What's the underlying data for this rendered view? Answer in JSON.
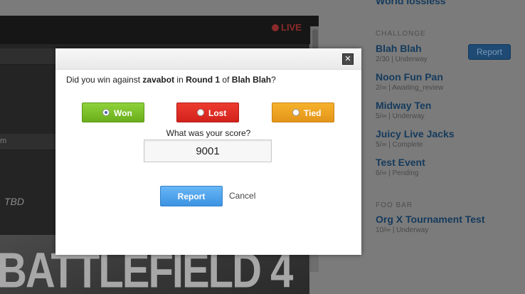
{
  "background": {
    "live_label": "LIVE",
    "strip_label": "m",
    "tbd_text": "TBD",
    "banner_text": "BATTLEFIELD 4",
    "top_clipped_title": "World lossless",
    "sections": [
      {
        "heading": "CHALLONGE",
        "events": [
          {
            "title": "Blah Blah",
            "meta": "2/30 | Underway"
          },
          {
            "title": "Noon Fun Pan",
            "meta": "2/∞ | Awaiting_review"
          },
          {
            "title": "Midway Ten",
            "meta": "5/∞ | Underway"
          },
          {
            "title": "Juicy Live Jacks",
            "meta": "5/∞ | Complete"
          },
          {
            "title": "Test Event",
            "meta": "6/∞ | Pending"
          }
        ]
      },
      {
        "heading": "FOO BAR",
        "events": [
          {
            "title": "Org X Tournament Test",
            "meta": "10/∞ | Underway"
          }
        ]
      }
    ],
    "report_button_label": "Report"
  },
  "modal": {
    "close_glyph": "✕",
    "question": {
      "prefix": "Did you win against ",
      "opponent": "zavabot",
      "mid1": " in ",
      "round": "Round 1",
      "mid2": " of ",
      "event": "Blah Blah",
      "suffix": "?"
    },
    "choices": {
      "won": "Won",
      "lost": "Lost",
      "tied": "Tied",
      "selected": "won"
    },
    "score_label": "What was your score?",
    "score_value": "9001",
    "report_label": "Report",
    "cancel_label": "Cancel"
  },
  "colors": {
    "won": "#7bc22a",
    "lost": "#e02e25",
    "tied": "#eea322",
    "report": "#4aa3ec",
    "link_blue": "#143a5c"
  }
}
